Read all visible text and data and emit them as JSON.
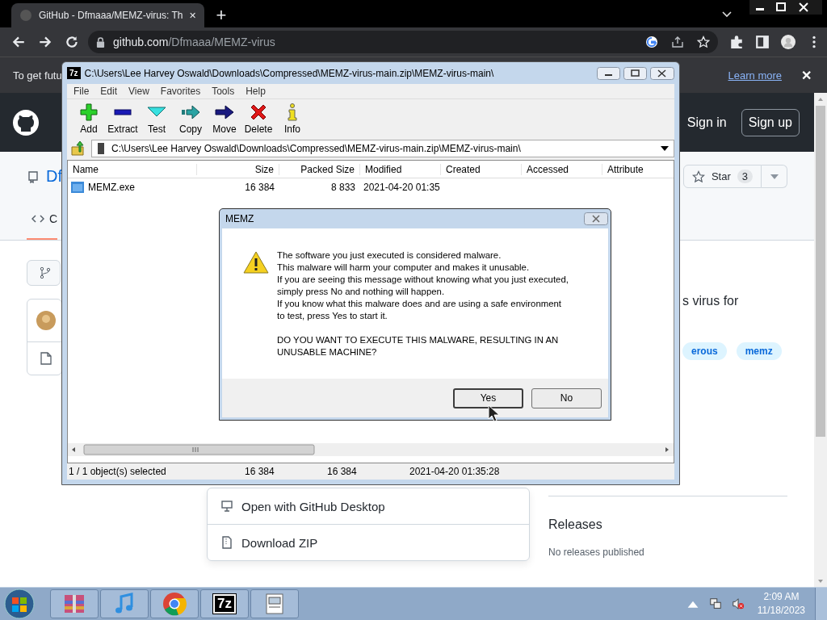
{
  "browser": {
    "tab": {
      "title": "GitHub - Dfmaaa/MEMZ-virus: Th",
      "close": "✕"
    },
    "new_tab": "+",
    "address": {
      "host": "github.com",
      "path": "/Dfmaaa/MEMZ-virus"
    },
    "infobar": {
      "text": "To get futu",
      "link": "Learn more",
      "close": "✕"
    }
  },
  "github": {
    "sign_in": "Sign in",
    "sign_up": "Sign up",
    "repo_title": "Df",
    "star": {
      "label": "Star",
      "count": "3"
    },
    "tabs": [
      {
        "label": "C",
        "selected": true
      }
    ],
    "about_text": "s virus for",
    "topics": [
      "erous",
      "memz"
    ],
    "clone_menu": [
      "Open with GitHub Desktop",
      "Download ZIP"
    ],
    "releases": {
      "heading": "Releases",
      "empty": "No releases published"
    }
  },
  "sevenzip": {
    "logo": "7z",
    "title": "C:\\Users\\Lee Harvey Oswald\\Downloads\\Compressed\\MEMZ-virus-main.zip\\MEMZ-virus-main\\",
    "menu": [
      "File",
      "Edit",
      "View",
      "Favorites",
      "Tools",
      "Help"
    ],
    "toolbar": [
      {
        "label": "Add",
        "kind": "add"
      },
      {
        "label": "Extract",
        "kind": "extract"
      },
      {
        "label": "Test",
        "kind": "test"
      },
      {
        "label": "Copy",
        "kind": "copy"
      },
      {
        "label": "Move",
        "kind": "move"
      },
      {
        "label": "Delete",
        "kind": "delete"
      },
      {
        "label": "Info",
        "kind": "info"
      }
    ],
    "path": "C:\\Users\\Lee Harvey Oswald\\Downloads\\Compressed\\MEMZ-virus-main.zip\\MEMZ-virus-main\\",
    "columns": [
      "Name",
      "Size",
      "Packed Size",
      "Modified",
      "Created",
      "Accessed",
      "Attribute"
    ],
    "rows": [
      {
        "cells": [
          "MEMZ.exe",
          "16 384",
          "8 833",
          "2021-04-20 01:35"
        ]
      }
    ],
    "status": [
      "1 / 1 object(s) selected",
      "16 384",
      "16 384",
      "2021-04-20 01:35:28"
    ]
  },
  "dialog": {
    "title": "MEMZ",
    "message": [
      "The software you just executed is considered malware.",
      "This malware will harm your computer and makes it unusable.",
      "If you are seeing this message without knowing what you just executed,",
      "simply press No and nothing will happen.",
      "If you know what this malware does and are using a safe environment",
      "to test, press Yes to start it."
    ],
    "question": [
      "DO YOU WANT TO EXECUTE THIS MALWARE, RESULTING IN AN",
      "UNUSABLE MACHINE?"
    ],
    "buttons": [
      {
        "label": "Yes",
        "default": true
      },
      {
        "label": "No",
        "default": false
      }
    ]
  },
  "taskbar": {
    "apps": [
      {
        "kind": "archive"
      },
      {
        "kind": "music"
      },
      {
        "kind": "browser"
      },
      {
        "kind": "sevenzip",
        "label": "7z"
      },
      {
        "kind": "window"
      }
    ],
    "time": "2:09 AM",
    "date": "11/18/2023"
  }
}
